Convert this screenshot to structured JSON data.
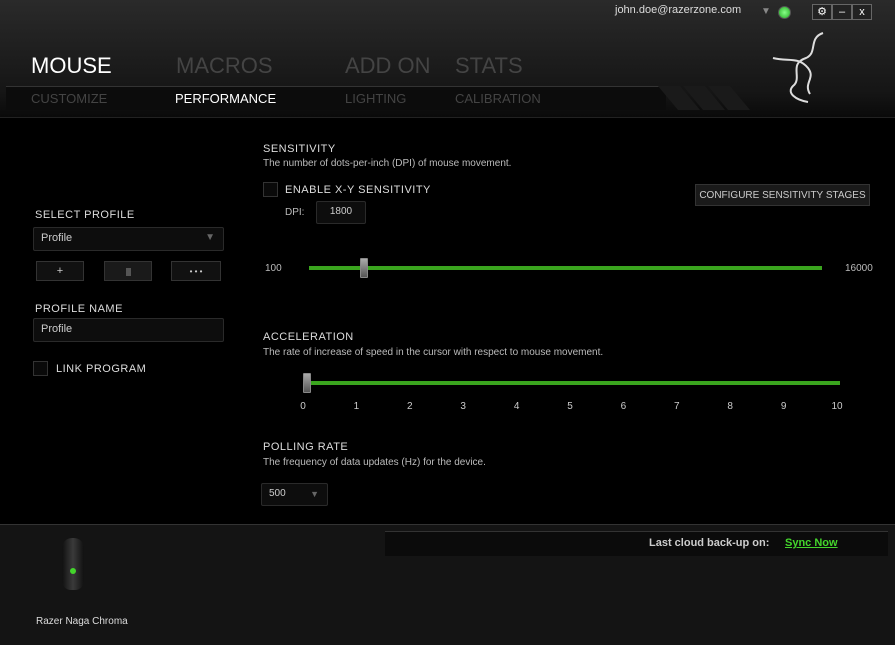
{
  "header": {
    "user_email": "john.doe@razerzone.com",
    "status_color": "#44d62c",
    "window_buttons": [
      {
        "icon": "gear-icon",
        "label": "⚙"
      },
      {
        "icon": "minimize-icon",
        "label": "–"
      },
      {
        "icon": "close-icon",
        "label": "x"
      }
    ],
    "main_tabs": [
      {
        "label": "MOUSE",
        "active": true
      },
      {
        "label": "MACROS"
      },
      {
        "label": "ADD ON"
      },
      {
        "label": "STATS"
      }
    ],
    "sub_tabs": [
      {
        "label": "CUSTOMIZE"
      },
      {
        "label": "PERFORMANCE",
        "active": true
      },
      {
        "label": "LIGHTING"
      },
      {
        "label": "CALIBRATION"
      }
    ]
  },
  "sidebar": {
    "select_profile_label": "SELECT PROFILE",
    "profile_selected": "Profile",
    "add_label": "+",
    "more_label": "• • •",
    "profile_name_label": "PROFILE NAME",
    "profile_name_value": "Profile",
    "link_program_label": "LINK PROGRAM",
    "link_program_checked": false
  },
  "sensitivity": {
    "title": "SENSITIVITY",
    "description": "The number of dots-per-inch (DPI) of mouse movement.",
    "enable_xy_label": "ENABLE X-Y SENSITIVITY",
    "enable_xy_checked": false,
    "dpi_label": "DPI:",
    "dpi_value": "1800",
    "configure_label": "CONFIGURE SENSITIVITY STAGES",
    "min": "100",
    "max": "16000",
    "value": 1800
  },
  "acceleration": {
    "title": "ACCELERATION",
    "description": "The rate of increase of speed in the cursor with respect to mouse movement.",
    "ticks": [
      "0",
      "1",
      "2",
      "3",
      "4",
      "5",
      "6",
      "7",
      "8",
      "9",
      "10"
    ],
    "value": 0
  },
  "polling": {
    "title": "POLLING RATE",
    "description": "The frequency of data updates (Hz) for the device.",
    "value": "500"
  },
  "footer": {
    "device_name": "Razer Naga Chroma",
    "backup_label": "Last cloud back-up on:",
    "sync_label": "Sync Now",
    "accent": "#44d62c"
  }
}
